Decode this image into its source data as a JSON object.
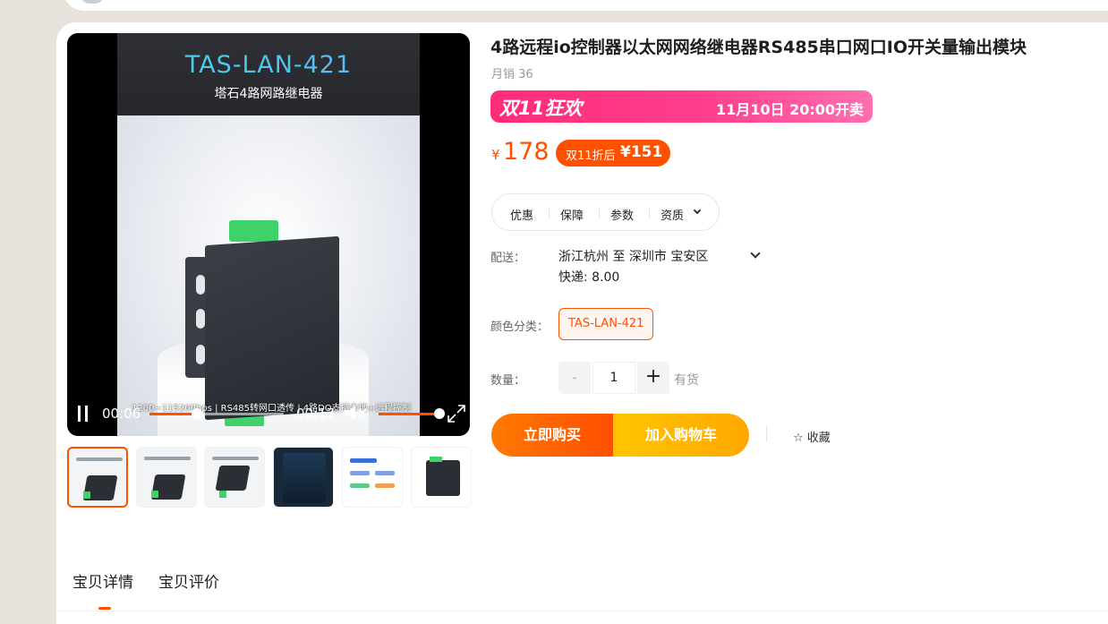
{
  "video": {
    "frame_title": "TAS-LAN-421",
    "frame_subtitle": "塔石4路网路继电器",
    "caption": "1200~115200bps | RS485转网口透传 | 4路DO支持本地+远程控制",
    "current_time": "00:06",
    "duration": "00:17",
    "progress": 0.35,
    "volume": 0.82
  },
  "thumbnails": [
    "产品图1",
    "产品图2",
    "产品图3",
    "产品图4",
    "产品图5",
    "产品图6"
  ],
  "product": {
    "title": "4路远程io控制器以太网网络继电器RS485串口网口IO开关量输出模块",
    "monthly_sales": "月销 36"
  },
  "promo": {
    "logo": "双11狂欢",
    "start_time": "11月10日 20:00开卖"
  },
  "price": {
    "currency": "¥",
    "value": "178",
    "coupon_label": "双11折后",
    "coupon_value": "¥151"
  },
  "info_tabs": [
    "优惠",
    "保障",
    "参数",
    "资质"
  ],
  "delivery": {
    "label": "配送：",
    "route": "浙江杭州  至  深圳市    宝安区",
    "fee": "快递: 8.00"
  },
  "color": {
    "label": "颜色分类：",
    "selected": "TAS-LAN-421"
  },
  "quantity": {
    "label": "数量：",
    "minus": "-",
    "value": "1",
    "plus": "+",
    "stock": "有货"
  },
  "actions": {
    "buy_now": "立即购买",
    "add_cart": "加入购物车",
    "favorite": "☆ 收藏"
  },
  "detail_tabs": [
    "宝贝详情",
    "宝贝评价"
  ],
  "colors": {
    "accent": "#ff5000",
    "cart": "#ffb300",
    "promo": "#ff2c7a"
  }
}
